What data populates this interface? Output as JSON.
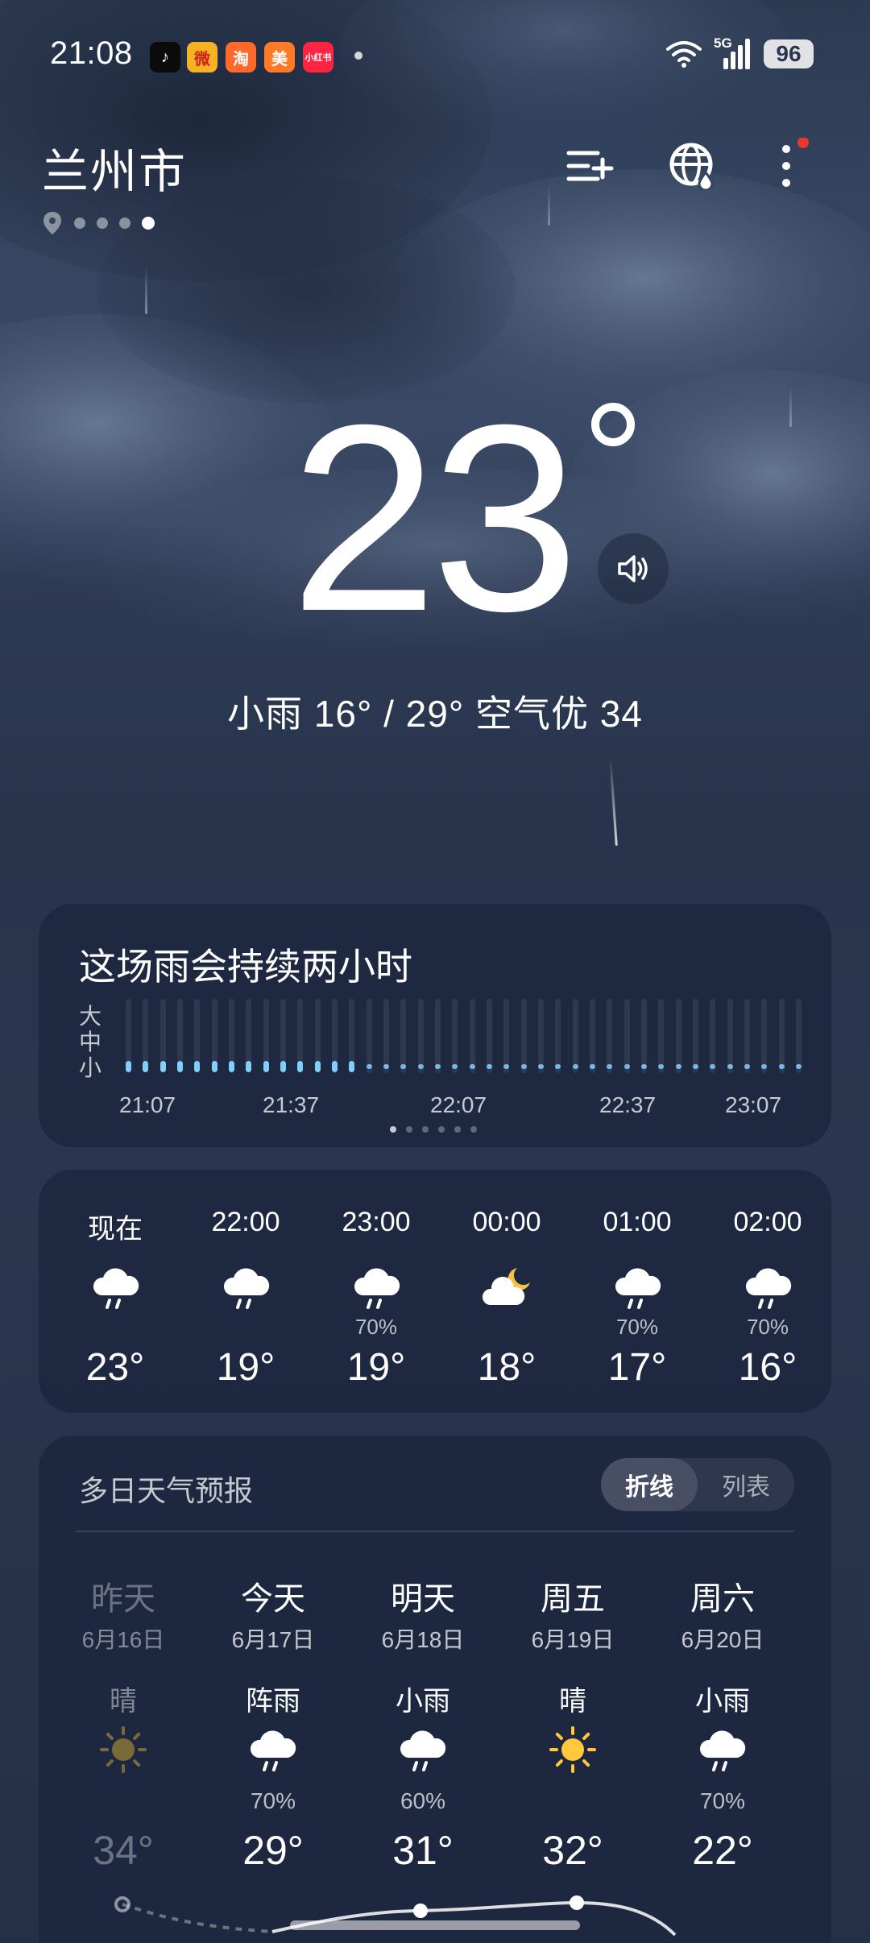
{
  "status_bar": {
    "time": "21:08",
    "network": "5G",
    "battery": "96",
    "apps": [
      {
        "name": "douyin-icon",
        "label": "♪",
        "bg": "#0b0b0b",
        "fg": "#ffffff"
      },
      {
        "name": "weibo-icon",
        "label": "微",
        "bg": "#f5b323",
        "fg": "#d0211c"
      },
      {
        "name": "taobao-icon",
        "label": "淘",
        "bg": "#ff6a2a",
        "fg": "#ffffff"
      },
      {
        "name": "meituan-icon",
        "label": "美",
        "bg": "#ff7a26",
        "fg": "#ffffff"
      },
      {
        "name": "xiaohongshu-icon",
        "label": "小红书",
        "bg": "#ff2442",
        "fg": "#ffffff"
      }
    ]
  },
  "header": {
    "city": "兰州市",
    "pages": 4,
    "active_page": 3
  },
  "current": {
    "temp": "23",
    "summary": "小雨  16° / 29°  空气优 34"
  },
  "rain_card": {
    "title": "这场雨会持续两小时",
    "intensity": [
      "大",
      "中",
      "小"
    ],
    "times": [
      "21:07",
      "21:37",
      "22:07",
      "22:37",
      "23:07"
    ],
    "bar_count": 40,
    "raining_bars": 14,
    "accent": "#7fd0ff"
  },
  "hourly": [
    {
      "time": "现在",
      "icon": "rain",
      "pct": "",
      "temp": "23°"
    },
    {
      "time": "22:00",
      "icon": "rain",
      "pct": "",
      "temp": "19°"
    },
    {
      "time": "23:00",
      "icon": "rain",
      "pct": "70%",
      "temp": "19°"
    },
    {
      "time": "00:00",
      "icon": "cloudy-night",
      "pct": "",
      "temp": "18°"
    },
    {
      "time": "01:00",
      "icon": "rain",
      "pct": "70%",
      "temp": "17°"
    },
    {
      "time": "02:00",
      "icon": "rain",
      "pct": "70%",
      "temp": "16°"
    }
  ],
  "daily": {
    "title": "多日天气预报",
    "toggle_active": "折线",
    "toggle_inactive": "列表",
    "days": [
      {
        "name": "昨天",
        "date": "6月16日",
        "cond": "晴",
        "icon": "sun",
        "pct": "",
        "temp": "34°",
        "past": true
      },
      {
        "name": "今天",
        "date": "6月17日",
        "cond": "阵雨",
        "icon": "rain",
        "pct": "70%",
        "temp": "29°",
        "past": false
      },
      {
        "name": "明天",
        "date": "6月18日",
        "cond": "小雨",
        "icon": "rain",
        "pct": "60%",
        "temp": "31°",
        "past": false
      },
      {
        "name": "周五",
        "date": "6月19日",
        "cond": "晴",
        "icon": "sun",
        "pct": "",
        "temp": "32°",
        "past": false
      },
      {
        "name": "周六",
        "date": "6月20日",
        "cond": "小雨",
        "icon": "rain",
        "pct": "70%",
        "temp": "22°",
        "past": false
      }
    ]
  }
}
